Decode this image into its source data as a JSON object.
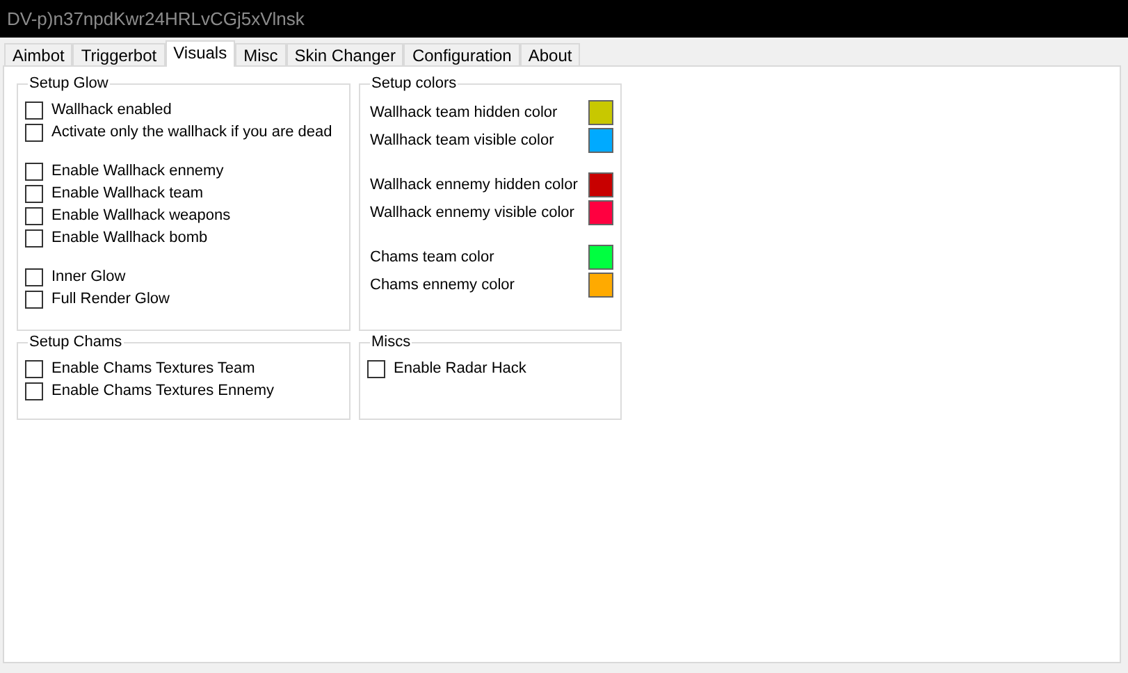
{
  "window": {
    "title": "DV-p)n37npdKwr24HRLvCGj5xVlnsk"
  },
  "tabs": [
    {
      "label": "Aimbot",
      "selected": false
    },
    {
      "label": "Triggerbot",
      "selected": false
    },
    {
      "label": "Visuals",
      "selected": true
    },
    {
      "label": "Misc",
      "selected": false
    },
    {
      "label": "Skin Changer",
      "selected": false
    },
    {
      "label": "Configuration",
      "selected": false
    },
    {
      "label": "About",
      "selected": false
    }
  ],
  "setup_glow": {
    "title": "Setup Glow",
    "groups": [
      [
        {
          "label": "Wallhack enabled",
          "checked": false
        },
        {
          "label": "Activate only the wallhack if you are dead",
          "checked": false
        }
      ],
      [
        {
          "label": "Enable Wallhack ennemy",
          "checked": false
        },
        {
          "label": "Enable Wallhack team",
          "checked": false
        },
        {
          "label": "Enable Wallhack weapons",
          "checked": false
        },
        {
          "label": "Enable Wallhack bomb",
          "checked": false
        }
      ],
      [
        {
          "label": "Inner Glow",
          "checked": false
        },
        {
          "label": "Full Render Glow",
          "checked": false
        }
      ]
    ]
  },
  "setup_colors": {
    "title": "Setup colors",
    "groups": [
      [
        {
          "label": "Wallhack team hidden color",
          "color": "#c8c800"
        },
        {
          "label": "Wallhack team visible color",
          "color": "#00aaff"
        }
      ],
      [
        {
          "label": "Wallhack ennemy hidden color",
          "color": "#c80000"
        },
        {
          "label": "Wallhack ennemy visible color",
          "color": "#ff0040"
        }
      ],
      [
        {
          "label": "Chams team color",
          "color": "#00ff40"
        },
        {
          "label": "Chams ennemy color",
          "color": "#ffaa00"
        }
      ]
    ]
  },
  "setup_chams": {
    "title": "Setup Chams",
    "groups": [
      [
        {
          "label": "Enable Chams Textures Team",
          "checked": false
        },
        {
          "label": "Enable Chams Textures Ennemy",
          "checked": false
        }
      ]
    ]
  },
  "miscs": {
    "title": "Miscs",
    "groups": [
      [
        {
          "label": "Enable Radar Hack",
          "checked": false
        }
      ]
    ]
  }
}
